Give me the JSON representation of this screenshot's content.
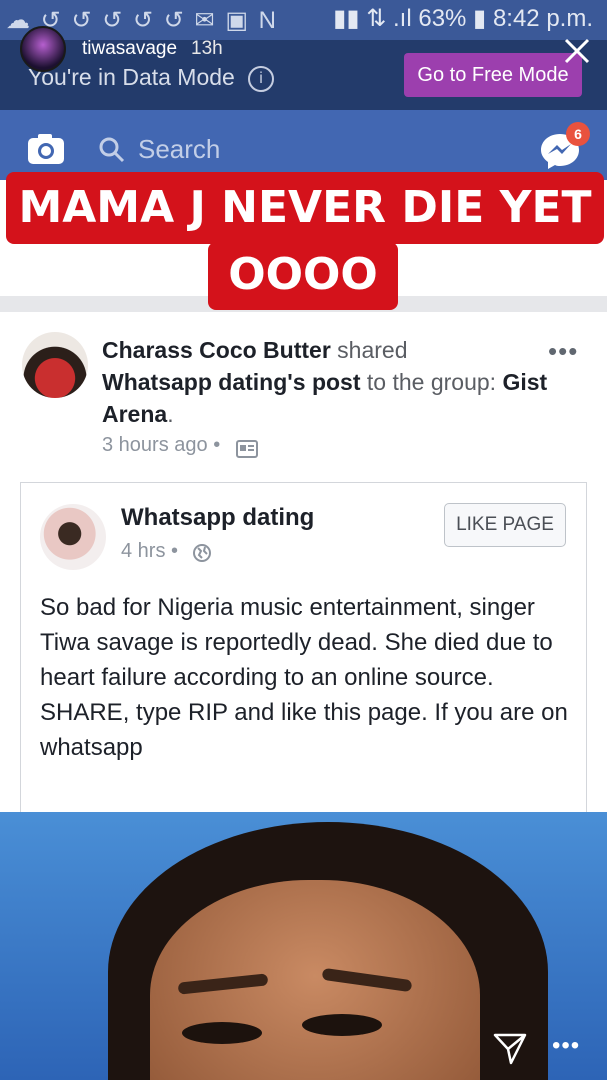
{
  "status_bar": {
    "notification_icons": "☁ ↺ ↺ ↺ ↺ ↺ ✉ ▣ N",
    "battery": "63%",
    "time": "8:42 p.m."
  },
  "data_mode": {
    "text": "You're in Data Mode",
    "button": "Go to Free Mode"
  },
  "story": {
    "username": "tiwasavage",
    "time": "13h",
    "caption_line1": "MAMA J NEVER DIE YET",
    "caption_line2": "OOOO"
  },
  "fb_header": {
    "search_placeholder": "Search",
    "messenger_badge": "6"
  },
  "post": {
    "author": "Charass Coco Butter",
    "shared_text": " shared ",
    "source_page": "Whatsapp dating",
    "source_suffix": "'s ",
    "post_word": "post",
    "to_group": " to the group: ",
    "group_name": "Gist Arena",
    "period": ".",
    "time": "3 hours ago",
    "more": "•••"
  },
  "shared_card": {
    "page_name": "Whatsapp dating",
    "time": "4 hrs",
    "like_button": "LIKE PAGE",
    "body": "So bad for Nigeria music entertainment, singer Tiwa savage is reportedly dead. She died due to heart failure according to an online source.",
    "body2": "SHARE, type RIP and like this page. If you are on whatsapp"
  },
  "footer": {
    "more": "•••"
  },
  "colors": {
    "fb_blue": "#4267b2",
    "caption_red": "#d4121b",
    "free_mode_purple": "#9c3fae"
  }
}
